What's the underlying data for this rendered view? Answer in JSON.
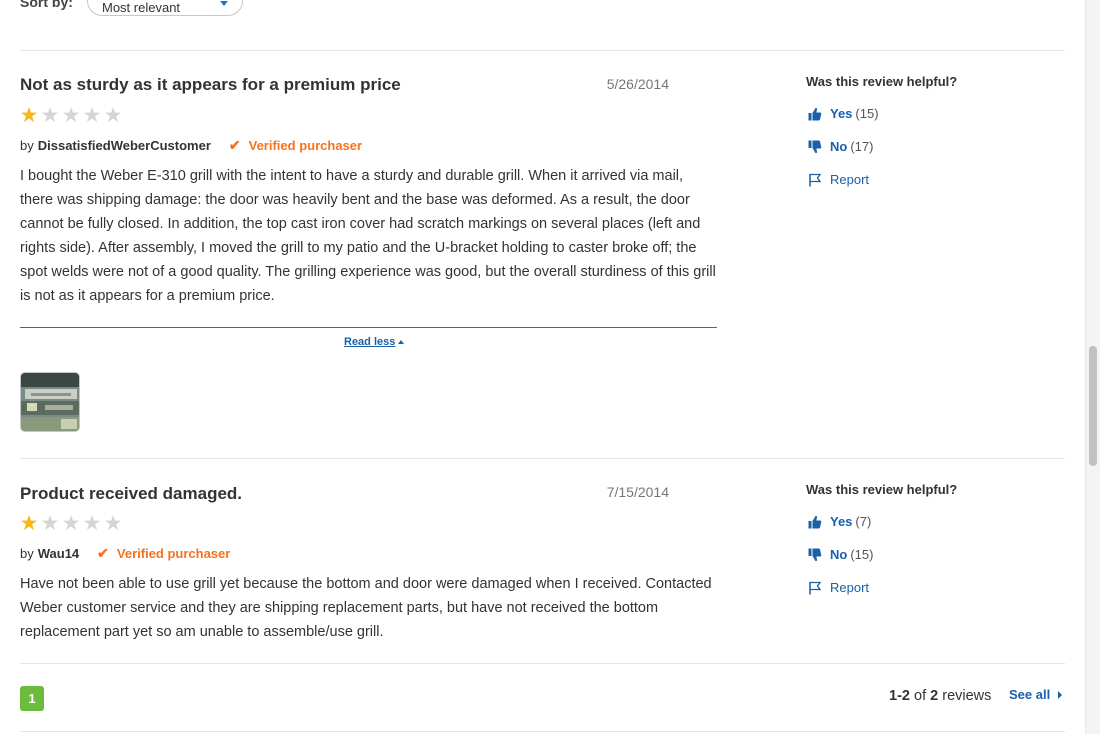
{
  "sort": {
    "label": "Sort by:",
    "selected": "Most relevant"
  },
  "reviews": [
    {
      "title": "Not as sturdy as it appears for a premium price",
      "date": "5/26/2014",
      "rating": 1,
      "rating_max": 5,
      "by": "by",
      "author": "DissatisfiedWeberCustomer",
      "verified": "Verified purchaser",
      "body": "I bought the Weber E-310 grill with the intent to have a sturdy and durable grill. When it arrived via mail, there was shipping damage: the door was heavily bent and the base was deformed. As a result, the door cannot be fully closed. In addition, the top cast iron cover had scratch markings on several places (left and rights side). After assembly, I moved the grill to my patio and the U-bracket holding to caster broke off; the spot welds were not of a good quality. The grilling experience was good, but the overall sturdiness of this grill is not as it appears for a premium price.",
      "read_less": "Read less",
      "helpful": {
        "title": "Was this review helpful?",
        "yes_label": "Yes",
        "yes_count": "(15)",
        "no_label": "No",
        "no_count": "(17)",
        "report_label": "Report"
      }
    },
    {
      "title": "Product received damaged.",
      "date": "7/15/2014",
      "rating": 1,
      "rating_max": 5,
      "by": "by",
      "author": "Wau14",
      "verified": "Verified purchaser",
      "body": "Have not been able to use grill yet because the bottom and door were damaged when I received. Contacted Weber customer service and they are shipping replacement parts, but have not received the bottom replacement part yet so am unable to assemble/use grill.",
      "helpful": {
        "title": "Was this review helpful?",
        "yes_label": "Yes",
        "yes_count": "(7)",
        "no_label": "No",
        "no_count": "(15)",
        "report_label": "Report"
      }
    }
  ],
  "pagination": {
    "current_page": "1",
    "range_start_end": "1-2",
    "of": "of",
    "total": "2",
    "reviews_word": "reviews",
    "see_all": "See all"
  },
  "icons": {
    "star": "star-icon",
    "thumbs_up": "thumbs-up-icon",
    "thumbs_down": "thumbs-down-icon",
    "flag": "flag-icon",
    "check": "checkmark-icon"
  },
  "colors": {
    "star_on": "#f8b619",
    "star_off": "#d5d5d5",
    "link_blue": "#1a5fa8",
    "verified_orange": "#f47321",
    "page_green": "#6cbb3c"
  }
}
